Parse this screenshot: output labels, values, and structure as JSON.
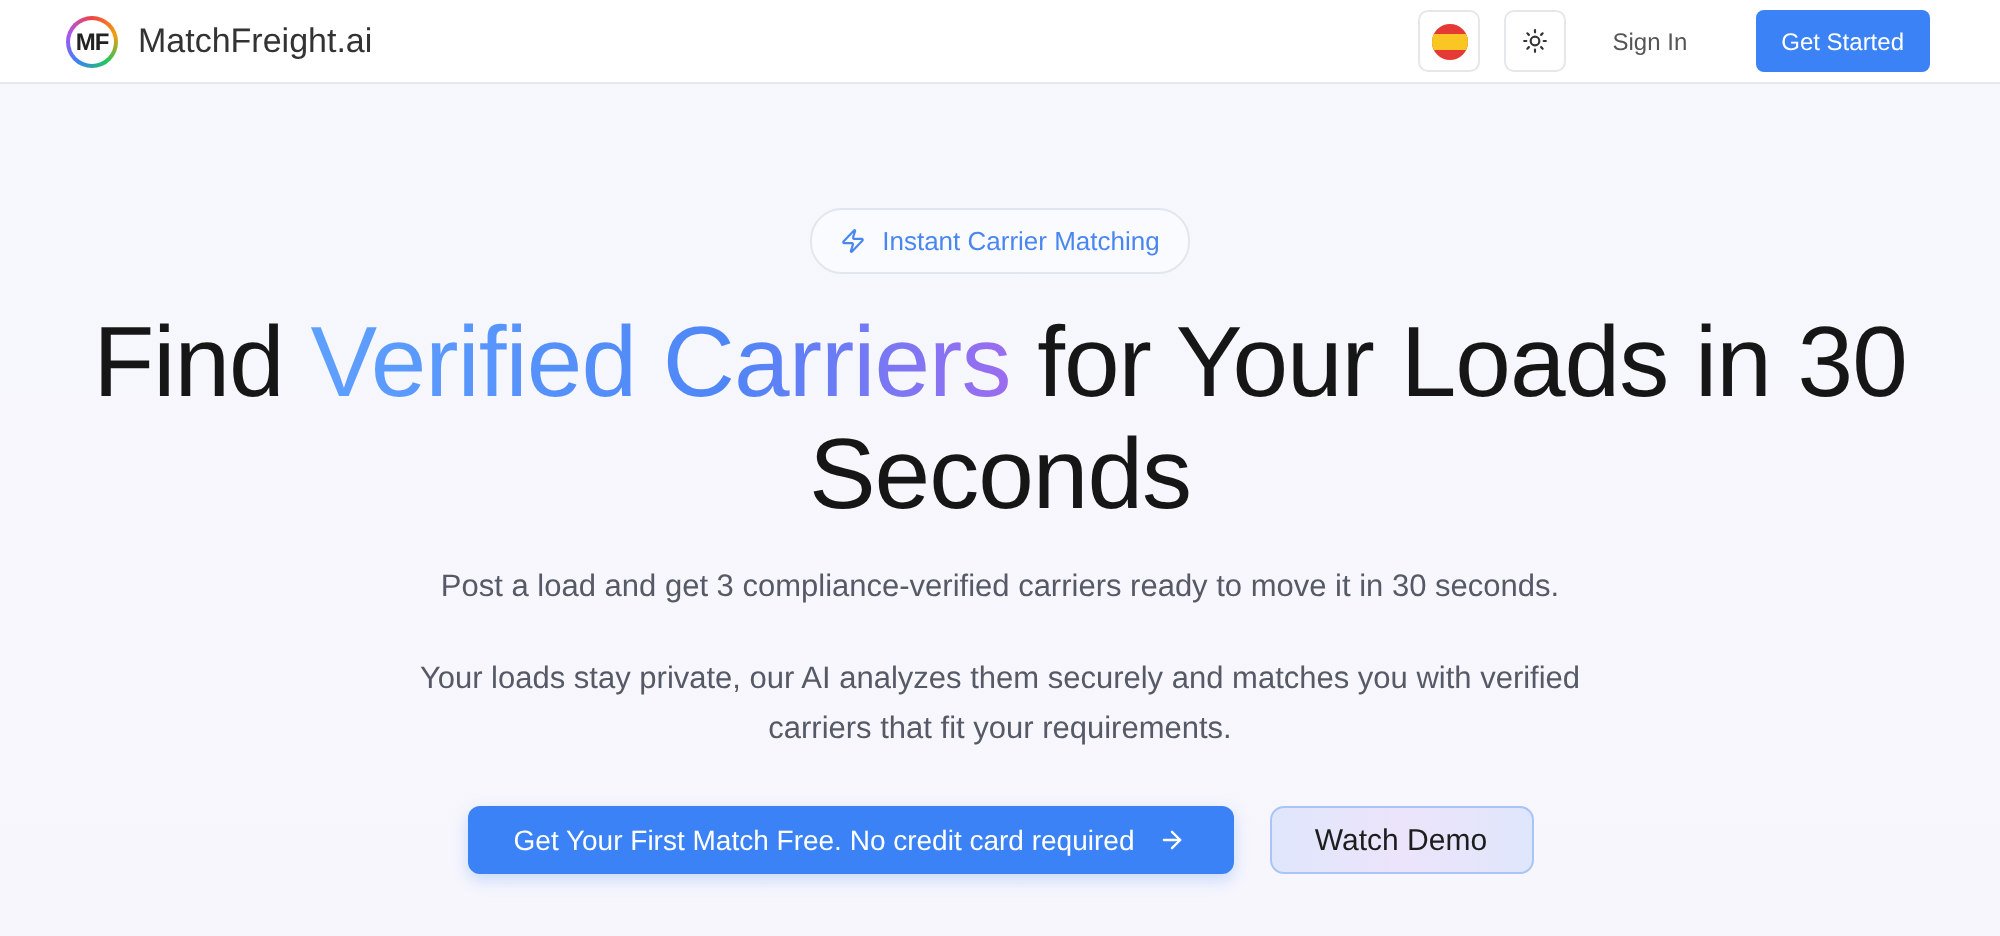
{
  "header": {
    "logo_mark": "MF",
    "brand": "MatchFreight.ai",
    "sign_in": "Sign In",
    "get_started": "Get Started"
  },
  "hero": {
    "badge": "Instant Carrier Matching",
    "headline": {
      "before": "Find ",
      "highlight": "Verified Carriers",
      "after": " for Your Loads in 30 Seconds"
    },
    "subtitle": "Post a load and get 3 compliance-verified carriers ready to move it in 30 seconds.",
    "description": "Your loads stay private, our AI analyzes them securely and matches you with verified carriers that fit your requirements.",
    "primary_cta": "Get Your First Match Free. No credit card required",
    "secondary_cta": "Watch Demo"
  }
}
